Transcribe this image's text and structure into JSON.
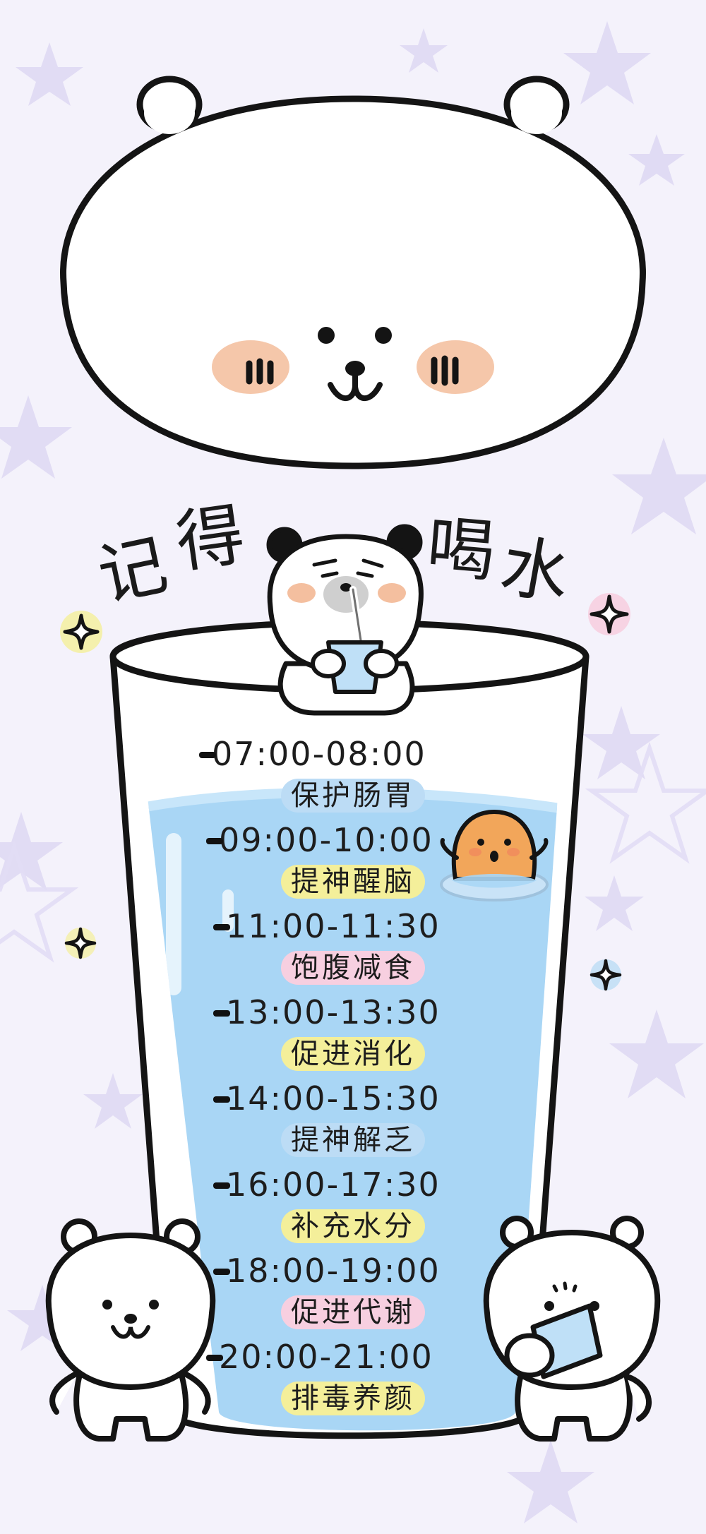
{
  "title": {
    "part1": [
      "记",
      "得"
    ],
    "part2": [
      "喝",
      "水"
    ]
  },
  "schedule": [
    {
      "time": "07:00-08:00",
      "benefit": "保护肠胃",
      "highlight": "#bcdcf5"
    },
    {
      "time": "09:00-10:00",
      "benefit": "提神醒脑",
      "highlight": "#f4ef9a"
    },
    {
      "time": "11:00-11:30",
      "benefit": "饱腹减食",
      "highlight": "#f7cfe0"
    },
    {
      "time": "13:00-13:30",
      "benefit": "促进消化",
      "highlight": "#f4ef9a"
    },
    {
      "time": "14:00-15:30",
      "benefit": "提神解乏",
      "highlight": "#bcdcf5"
    },
    {
      "time": "16:00-17:30",
      "benefit": "补充水分",
      "highlight": "#f4ef9a"
    },
    {
      "time": "18:00-19:00",
      "benefit": "促进代谢",
      "highlight": "#f7cfe0"
    },
    {
      "time": "20:00-21:00",
      "benefit": "排毒养颜",
      "highlight": "#f4ef9a"
    }
  ],
  "colors": {
    "background": "#f4f2fb",
    "water": "#a9d6f5",
    "star": "#d9d3f2",
    "blush": "#f2b48e",
    "seal": "#f2a65a"
  },
  "icons": [
    "big-bear-face-illustration",
    "panda-drinking-icon",
    "seal-icon",
    "bear-left-icon",
    "bear-right-icon",
    "sparkle-icon"
  ]
}
